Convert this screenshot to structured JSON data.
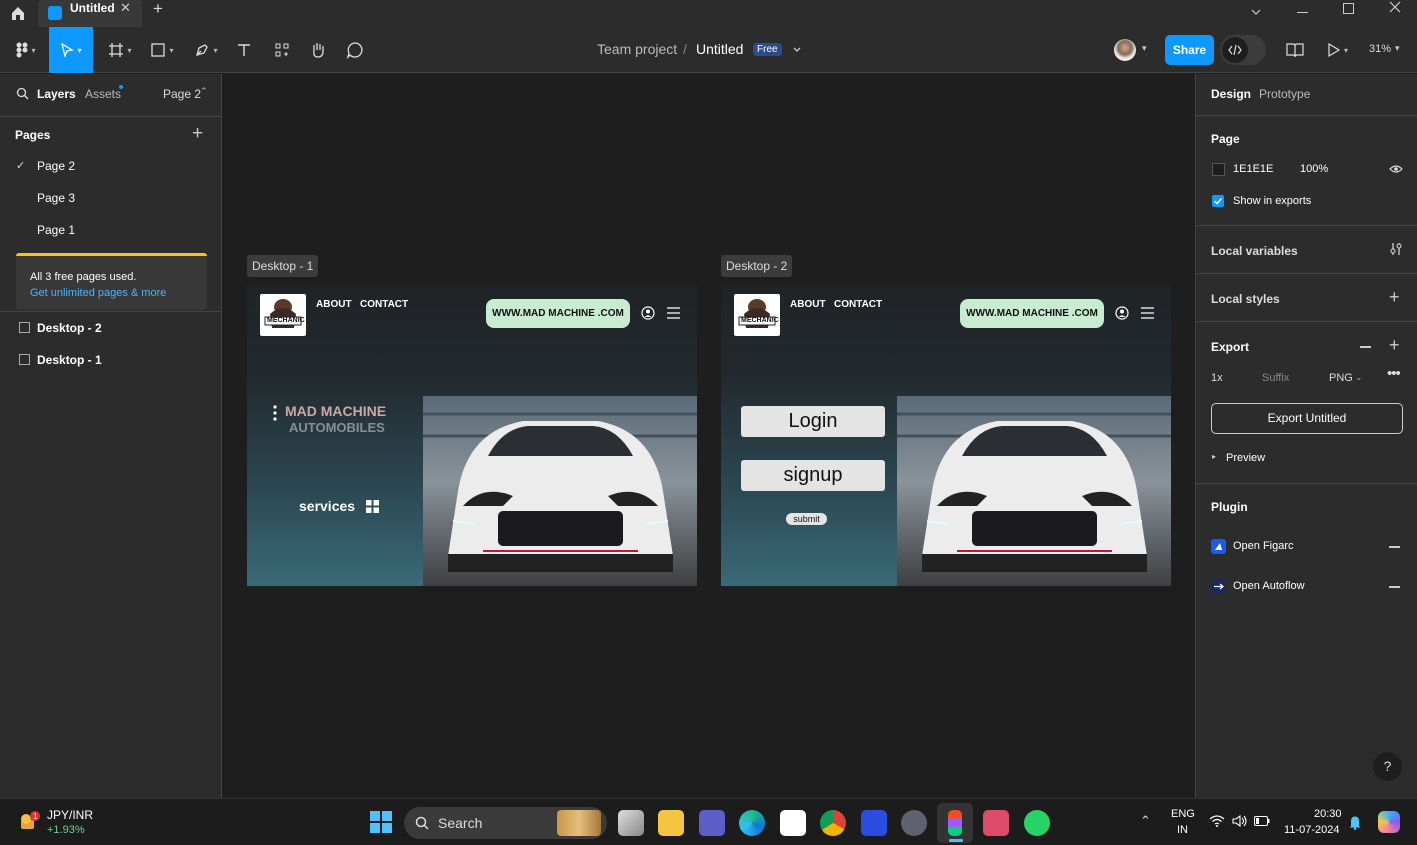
{
  "titlebar": {
    "tab_title": "Untitled",
    "new_tab": "+",
    "close_tab": "✕"
  },
  "toolbar": {
    "project": "Team project",
    "slash": "/",
    "file": "Untitled",
    "plan_badge": "Free",
    "share": "Share",
    "zoom": "31%"
  },
  "left": {
    "tab_layers": "Layers",
    "tab_assets": "Assets",
    "page_select": "Page 2",
    "pages_header": "Pages",
    "pages": [
      "Page 2",
      "Page 3",
      "Page 1"
    ],
    "notice_title": "All 3 free pages used.",
    "notice_link": "Get unlimited pages & more",
    "layers": [
      "Desktop - 2",
      "Desktop - 1"
    ]
  },
  "canvas": {
    "frame1_label": "Desktop - 1",
    "frame2_label": "Desktop - 2",
    "nav_about": "ABOUT",
    "nav_contact": "CONTACT",
    "url_pill": "WWW.MAD MACHINE .COM",
    "brand_line1": "MAD MACHINE",
    "brand_line2": "AUTOMOBILES",
    "services": "services",
    "login": "Login",
    "signup": "signup",
    "submit": "submit",
    "logo_text": "MECHANIC"
  },
  "right": {
    "tab_design": "Design",
    "tab_prototype": "Prototype",
    "page_header": "Page",
    "bg_hex": "1E1E1E",
    "bg_opacity": "100%",
    "show_in_exports": "Show in exports",
    "local_variables": "Local variables",
    "local_styles": "Local styles",
    "export_header": "Export",
    "export_scale": "1x",
    "export_suffix_placeholder": "Suffix",
    "export_format": "PNG",
    "export_button": "Export Untitled",
    "preview": "Preview",
    "plugin_header": "Plugin",
    "plugins": [
      "Open Figarc",
      "Open Autoflow"
    ],
    "help": "?"
  },
  "taskbar": {
    "ticker": "JPY/INR",
    "ticker_change": "+1.93%",
    "search": "Search",
    "lang1": "ENG",
    "lang2": "IN",
    "time": "20:30",
    "date": "11-07-2024"
  },
  "colors": {
    "accent": "#0d99ff",
    "badge": "#2c4a8c",
    "pill": "#c8ecd0",
    "notice_bar": "#ffc01e"
  }
}
